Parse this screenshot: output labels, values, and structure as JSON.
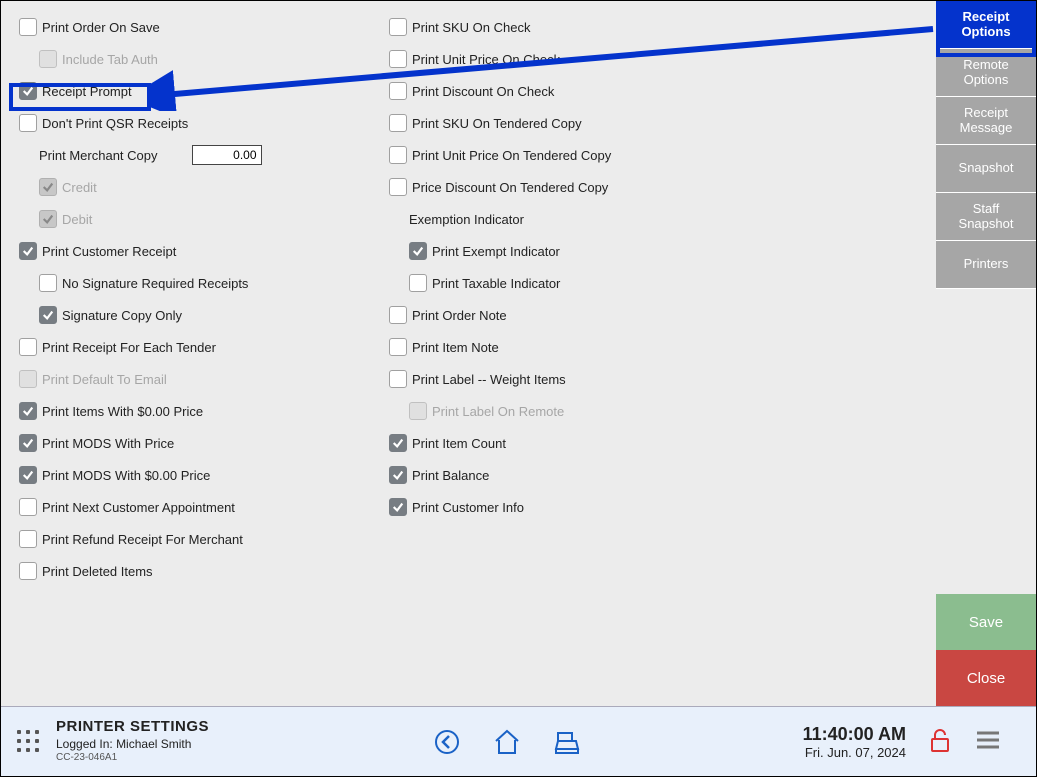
{
  "left_options": [
    {
      "id": "print-order-on-save",
      "label": "Print Order On Save",
      "checked": false,
      "disabled": false,
      "indent": 0
    },
    {
      "id": "include-tab-auth",
      "label": "Include Tab Auth",
      "checked": false,
      "disabled": true,
      "indent": 1
    },
    {
      "id": "receipt-prompt",
      "label": "Receipt Prompt",
      "checked": true,
      "disabled": false,
      "indent": 0
    },
    {
      "id": "dont-print-qsr-receipts",
      "label": "Don't Print QSR Receipts",
      "checked": false,
      "disabled": false,
      "indent": 0
    }
  ],
  "merchant_copy": {
    "label": "Print Merchant Copy",
    "value": "0.00"
  },
  "merchant_sub": [
    {
      "id": "credit",
      "label": "Credit",
      "checked": true,
      "disabled": true,
      "indent": 1
    },
    {
      "id": "debit",
      "label": "Debit",
      "checked": true,
      "disabled": true,
      "indent": 1
    }
  ],
  "customer_receipt": [
    {
      "id": "print-customer-receipt",
      "label": "Print Customer Receipt",
      "checked": true,
      "disabled": false,
      "indent": 0
    },
    {
      "id": "no-signature-required-receipts",
      "label": "No Signature Required Receipts",
      "checked": false,
      "disabled": false,
      "indent": 1
    },
    {
      "id": "signature-copy-only",
      "label": "Signature Copy Only",
      "checked": true,
      "disabled": false,
      "indent": 1
    }
  ],
  "left_rest": [
    {
      "id": "print-receipt-for-each-tender",
      "label": "Print Receipt For Each Tender",
      "checked": false,
      "disabled": false,
      "indent": 0
    },
    {
      "id": "print-default-to-email",
      "label": "Print Default To Email",
      "checked": false,
      "disabled": true,
      "indent": 0
    },
    {
      "id": "print-items-with-0-price",
      "label": "Print Items With $0.00 Price",
      "checked": true,
      "disabled": false,
      "indent": 0
    },
    {
      "id": "print-mods-with-price",
      "label": "Print MODS With Price",
      "checked": true,
      "disabled": false,
      "indent": 0
    },
    {
      "id": "print-mods-with-0-price",
      "label": "Print MODS With $0.00 Price",
      "checked": true,
      "disabled": false,
      "indent": 0
    },
    {
      "id": "print-next-customer-appointment",
      "label": "Print Next Customer Appointment",
      "checked": false,
      "disabled": false,
      "indent": 0
    },
    {
      "id": "print-refund-receipt-for-merchant",
      "label": "Print Refund Receipt For Merchant",
      "checked": false,
      "disabled": false,
      "indent": 0
    },
    {
      "id": "print-deleted-items",
      "label": "Print Deleted Items",
      "checked": false,
      "disabled": false,
      "indent": 0
    }
  ],
  "right_top": [
    {
      "id": "print-sku-on-check",
      "label": "Print SKU On Check",
      "checked": false,
      "disabled": false,
      "indent": 0
    },
    {
      "id": "print-unit-price-on-check",
      "label": "Print Unit Price On Check",
      "checked": false,
      "disabled": false,
      "indent": 0
    },
    {
      "id": "print-discount-on-check",
      "label": "Print Discount On Check",
      "checked": false,
      "disabled": false,
      "indent": 0
    },
    {
      "id": "print-sku-on-tendered-copy",
      "label": "Print SKU On Tendered Copy",
      "checked": false,
      "disabled": false,
      "indent": 0
    },
    {
      "id": "print-unit-price-on-tendered-copy",
      "label": "Print Unit Price On Tendered Copy",
      "checked": false,
      "disabled": false,
      "indent": 0
    },
    {
      "id": "price-discount-on-tendered-copy",
      "label": "Price Discount On Tendered Copy",
      "checked": false,
      "disabled": false,
      "indent": 0
    }
  ],
  "exemption_heading": "Exemption Indicator",
  "exemption": [
    {
      "id": "print-exempt-indicator",
      "label": "Print Exempt Indicator",
      "checked": true,
      "disabled": false,
      "indent": 1
    },
    {
      "id": "print-taxable-indicator",
      "label": "Print Taxable Indicator",
      "checked": false,
      "disabled": false,
      "indent": 1
    }
  ],
  "right_rest": [
    {
      "id": "print-order-note",
      "label": "Print Order Note",
      "checked": false,
      "disabled": false,
      "indent": 0
    },
    {
      "id": "print-item-note",
      "label": "Print Item Note",
      "checked": false,
      "disabled": false,
      "indent": 0
    },
    {
      "id": "print-label-weight-items",
      "label": "Print Label -- Weight Items",
      "checked": false,
      "disabled": false,
      "indent": 0
    },
    {
      "id": "print-label-on-remote",
      "label": "Print Label On Remote",
      "checked": false,
      "disabled": true,
      "indent": 1
    },
    {
      "id": "print-item-count",
      "label": "Print Item Count",
      "checked": true,
      "disabled": false,
      "indent": 0
    },
    {
      "id": "print-balance",
      "label": "Print Balance",
      "checked": true,
      "disabled": false,
      "indent": 0
    },
    {
      "id": "print-customer-info",
      "label": "Print Customer Info",
      "checked": true,
      "disabled": false,
      "indent": 0
    }
  ],
  "sidebar_tabs": [
    {
      "id": "receipt-options",
      "label": "Receipt Options",
      "active": true
    },
    {
      "id": "remote-options",
      "label": "Remote Options",
      "active": false
    },
    {
      "id": "receipt-message",
      "label": "Receipt Message",
      "active": false
    },
    {
      "id": "snapshot",
      "label": "Snapshot",
      "active": false
    },
    {
      "id": "staff-snapshot",
      "label": "Staff Snapshot",
      "active": false
    },
    {
      "id": "printers",
      "label": "Printers",
      "active": false
    }
  ],
  "buttons": {
    "save": "Save",
    "close": "Close"
  },
  "status": {
    "title": "PRINTER SETTINGS",
    "logged_in_label": "Logged In:",
    "logged_in_user": "Michael Smith",
    "station": "CC-23-046A1",
    "time": "11:40:00 AM",
    "date": "Fri. Jun. 07, 2024"
  }
}
